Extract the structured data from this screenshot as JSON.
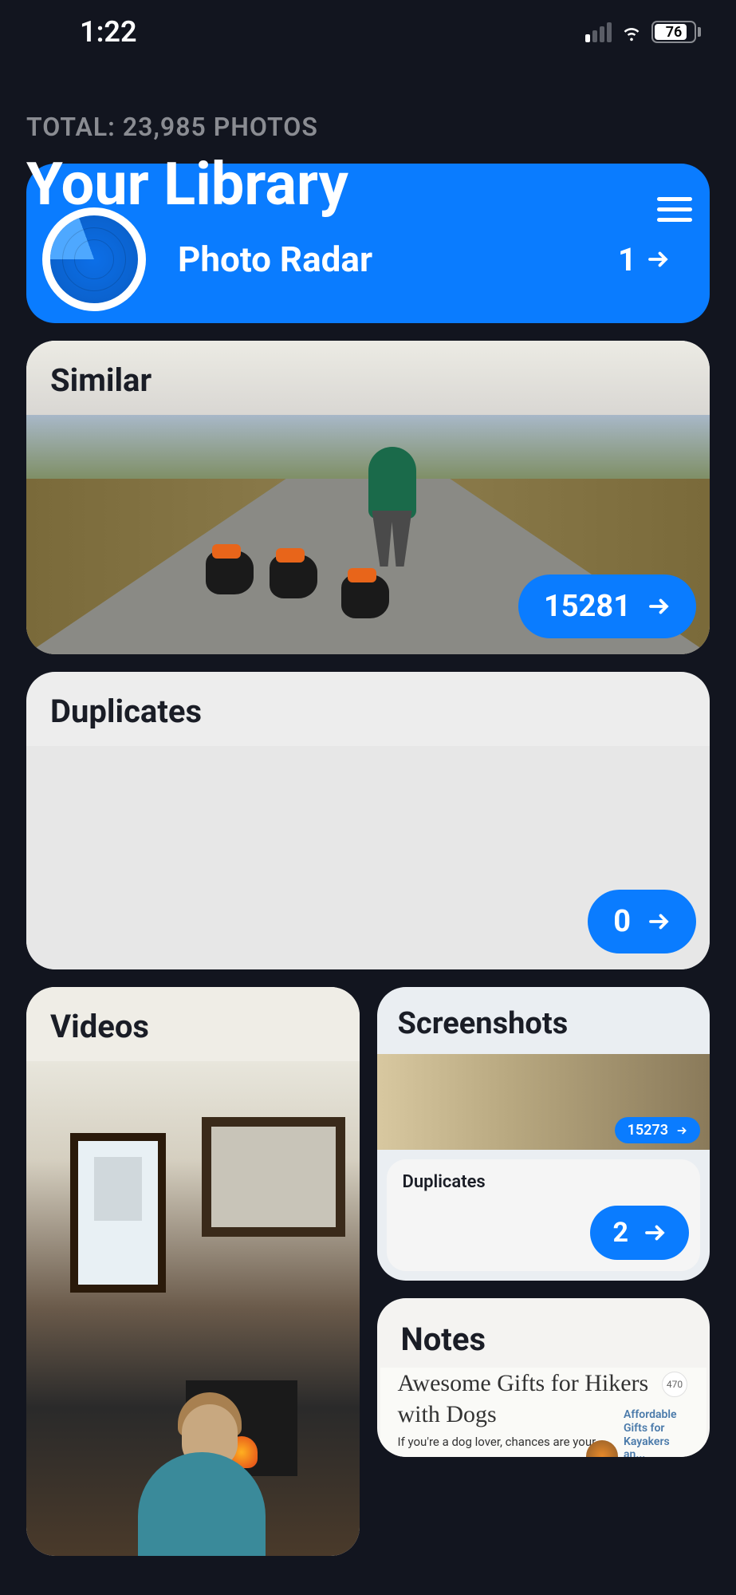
{
  "status_bar": {
    "time": "1:22",
    "battery": "76"
  },
  "header": {
    "total_label": "TOTAL: 23,985 PHOTOS",
    "title": "Your Library"
  },
  "radar": {
    "title": "Photo Radar",
    "count": "1"
  },
  "similar": {
    "title": "Similar",
    "count": "15281"
  },
  "duplicates": {
    "title": "Duplicates",
    "count": "0"
  },
  "videos": {
    "title": "Videos"
  },
  "screenshots": {
    "title": "Screenshots",
    "inner_count": "15273",
    "dup_label": "Duplicates",
    "dup_count": "2"
  },
  "notes": {
    "title": "Notes",
    "article_title": "Awesome Gifts for Hikers with Dogs",
    "article_sub": "If you're a dog lover, chances are your",
    "badge": "470",
    "link": "Affordable Gifts for Kayakers an..."
  }
}
